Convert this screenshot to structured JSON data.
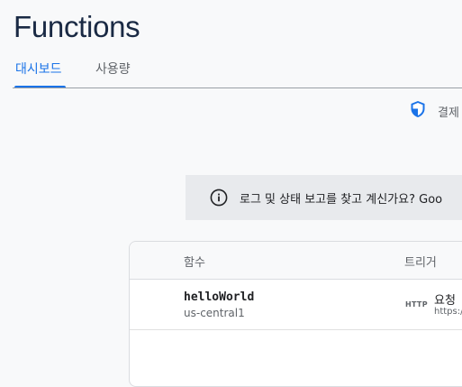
{
  "page": {
    "title": "Functions"
  },
  "tabs": [
    {
      "label": "대시보드",
      "active": true
    },
    {
      "label": "사용량",
      "active": false
    }
  ],
  "billing": {
    "label": "결제",
    "icon": "shield-icon"
  },
  "banner": {
    "icon": "info-icon",
    "text": "로그 및 상태 보고를 찾고 계신가요? Goo"
  },
  "table": {
    "headers": [
      "함수",
      "트리거"
    ],
    "rows": [
      {
        "name": "helloWorld",
        "region": "us-central1",
        "trigger_type": "HTTP",
        "trigger_label": "요청",
        "trigger_url": "https://"
      }
    ]
  },
  "colors": {
    "accent": "#1a73e8",
    "title": "#1a2a44",
    "banner_bg": "#e8eaed"
  }
}
